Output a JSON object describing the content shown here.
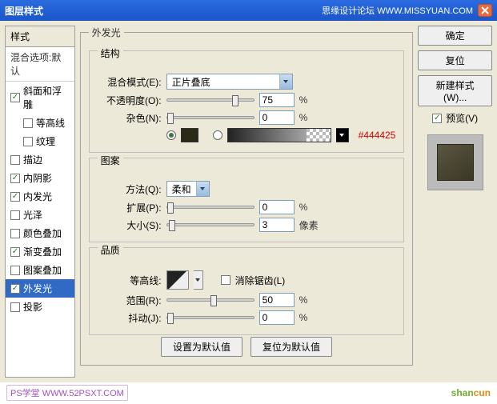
{
  "titlebar": {
    "title": "图层样式",
    "brand": "思缘设计论坛  WWW.MISSYUAN.COM"
  },
  "sidebar": {
    "header": "样式",
    "sub": "混合选项:默认",
    "items": [
      {
        "label": "斜面和浮雕",
        "checked": true,
        "indent": false
      },
      {
        "label": "等高线",
        "checked": false,
        "indent": true
      },
      {
        "label": "纹理",
        "checked": false,
        "indent": true
      },
      {
        "label": "描边",
        "checked": false,
        "indent": false
      },
      {
        "label": "内阴影",
        "checked": true,
        "indent": false
      },
      {
        "label": "内发光",
        "checked": true,
        "indent": false
      },
      {
        "label": "光泽",
        "checked": false,
        "indent": false
      },
      {
        "label": "颜色叠加",
        "checked": false,
        "indent": false
      },
      {
        "label": "渐变叠加",
        "checked": true,
        "indent": false
      },
      {
        "label": "图案叠加",
        "checked": false,
        "indent": false
      },
      {
        "label": "外发光",
        "checked": true,
        "indent": false,
        "active": true
      },
      {
        "label": "投影",
        "checked": false,
        "indent": false
      }
    ]
  },
  "panel": {
    "title": "外发光",
    "structure": {
      "title": "结构",
      "blend_label": "混合模式(E):",
      "blend_value": "正片叠底",
      "opacity_label": "不透明度(O):",
      "opacity_value": "75",
      "opacity_unit": "%",
      "noise_label": "杂色(N):",
      "noise_value": "0",
      "noise_unit": "%",
      "hex": "#444425"
    },
    "elements": {
      "title": "图案",
      "technique_label": "方法(Q):",
      "technique_value": "柔和",
      "spread_label": "扩展(P):",
      "spread_value": "0",
      "spread_unit": "%",
      "size_label": "大小(S):",
      "size_value": "3",
      "size_unit": "像素"
    },
    "quality": {
      "title": "品质",
      "contour_label": "等高线:",
      "antialias_label": "消除锯齿(L)",
      "antialias_checked": false,
      "range_label": "范围(R):",
      "range_value": "50",
      "range_unit": "%",
      "jitter_label": "抖动(J):",
      "jitter_value": "0",
      "jitter_unit": "%"
    },
    "defaults": {
      "make": "设置为默认值",
      "reset": "复位为默认值"
    }
  },
  "right": {
    "ok": "确定",
    "cancel": "复位",
    "newstyle": "新建样式(W)...",
    "preview_label": "预览(V)",
    "preview_checked": true
  },
  "footer": {
    "ps": "PS学堂  WWW.52PSXT.COM",
    "shancun1": "shan",
    "shancun2": "cun"
  }
}
